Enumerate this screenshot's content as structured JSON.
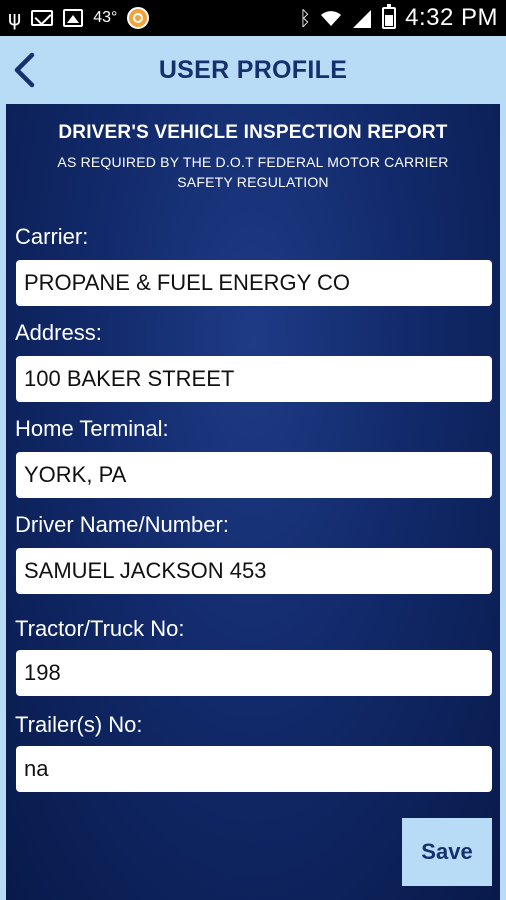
{
  "status_bar": {
    "temperature": "43°",
    "time": "4:32 PM"
  },
  "header": {
    "title": "USER PROFILE"
  },
  "report": {
    "title": "DRIVER'S VEHICLE INSPECTION REPORT",
    "subtitle": "AS REQUIRED BY THE D.O.T FEDERAL MOTOR CARRIER SAFETY REGULATION"
  },
  "fields": [
    {
      "label": "Carrier:",
      "value": "PROPANE & FUEL ENERGY CO"
    },
    {
      "label": "Address:",
      "value": "100 BAKER STREET"
    },
    {
      "label": "Home Terminal:",
      "value": "YORK, PA"
    },
    {
      "label": "Driver Name/Number:",
      "value": "SAMUEL JACKSON 453"
    },
    {
      "label": "Tractor/Truck No:",
      "value": "198"
    },
    {
      "label": "Trailer(s) No:",
      "value": "na"
    }
  ],
  "actions": {
    "save_label": "Save"
  },
  "colors": {
    "header_bg": "#b8dcf6",
    "title_text": "#16306e",
    "panel_bg": "#122a6b"
  }
}
